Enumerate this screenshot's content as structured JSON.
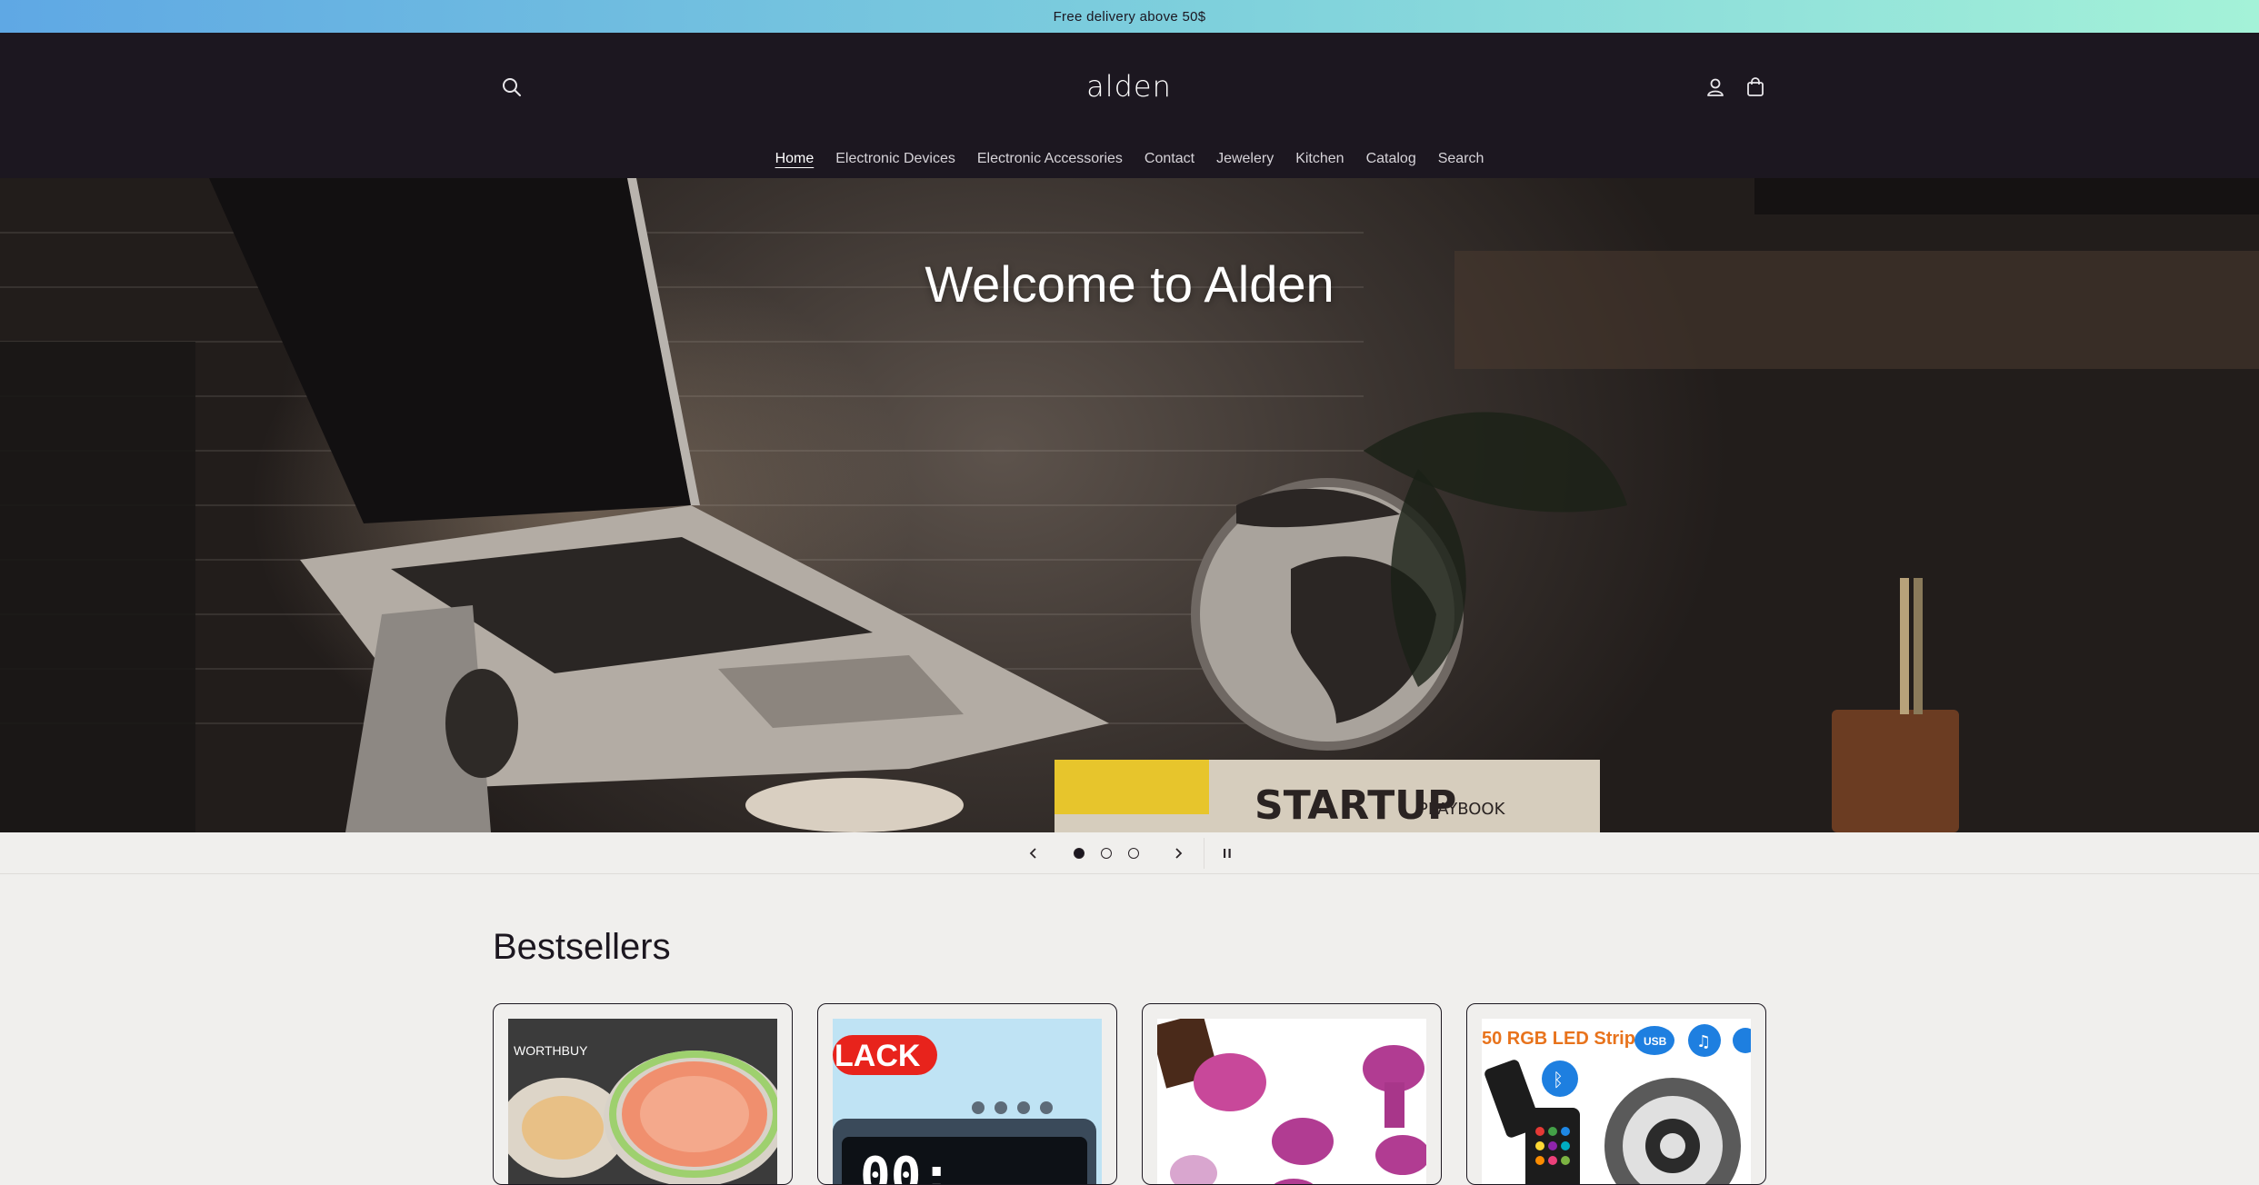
{
  "announcement": {
    "text": "Free delivery above 50$"
  },
  "header": {
    "logo": "alden",
    "search_icon": "search-icon",
    "account_icon": "account-icon",
    "cart_icon": "cart-icon"
  },
  "nav": {
    "items": [
      {
        "label": "Home",
        "active": true
      },
      {
        "label": "Electronic Devices"
      },
      {
        "label": "Electronic Accessories"
      },
      {
        "label": "Contact"
      },
      {
        "label": "Jewelery"
      },
      {
        "label": "Kitchen"
      },
      {
        "label": "Catalog"
      },
      {
        "label": "Search"
      }
    ]
  },
  "hero": {
    "title": "Welcome to Alden",
    "book_text": "STARTUP",
    "book_text_2": "PLAYBOOK"
  },
  "slider": {
    "current_slide": 1,
    "total_slides": 3,
    "prev_icon": "chevron-left-icon",
    "next_icon": "chevron-right-icon",
    "pause_icon": "pause-icon"
  },
  "bestsellers": {
    "title": "Bestsellers",
    "products": [
      {
        "image_text": "WORTHBUY"
      },
      {
        "image_text": "LACK"
      },
      {
        "image_text": ""
      },
      {
        "image_text": "50 RGB LED Strip",
        "badge": "USB"
      }
    ]
  },
  "colors": {
    "header_bg": "#1c1720",
    "page_bg": "#f0efed",
    "announcement_start": "#5fa8e4",
    "announcement_end": "#a4f2d8"
  }
}
